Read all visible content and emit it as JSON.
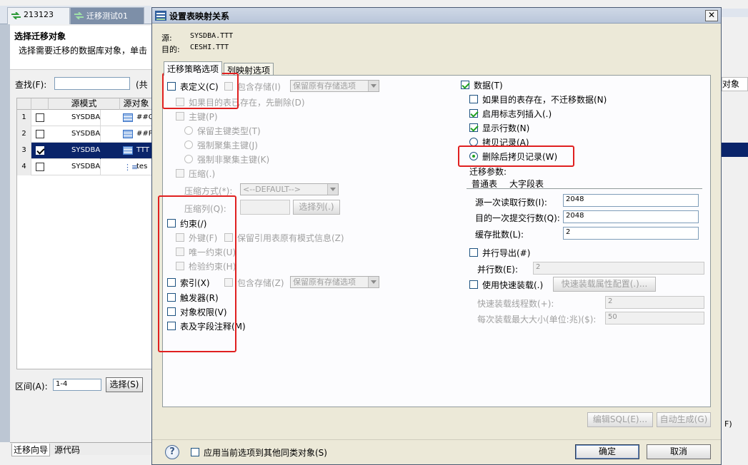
{
  "background": {
    "tabs": [
      {
        "label": "213123"
      },
      {
        "label": "迁移测试01"
      }
    ],
    "wizard_title": "选择迁移对象",
    "wizard_desc": "选择需要迁移的数据库对象，单击",
    "search_label": "查找(F):",
    "search_value": "",
    "search_count": "(共",
    "grid": {
      "headers": [
        "源模式",
        "源对象"
      ],
      "rows": [
        {
          "num": "1",
          "checked": false,
          "schema": "SYSDBA",
          "object": "##O"
        },
        {
          "num": "2",
          "checked": false,
          "schema": "SYSDBA",
          "object": "##P"
        },
        {
          "num": "3",
          "checked": true,
          "schema": "SYSDBA",
          "object": "TTT"
        },
        {
          "num": "4",
          "checked": false,
          "schema": "SYSDBA",
          "object": "tes"
        }
      ]
    },
    "range_label": "区间(A):",
    "range_value": "1-4",
    "select_button": "选择(S)",
    "bottom_tabs": [
      "迁移向导",
      "源代码"
    ],
    "right_object_label": "对象",
    "right_f_label": "F)"
  },
  "dialog": {
    "title": "设置表映射关系",
    "close": "✕",
    "source_label": "源:",
    "source_value": "SYSDBA.TTT",
    "target_label": "目的:",
    "target_value": "CESHI.TTT",
    "tabs": [
      "迁移策略选项",
      "列映射选项"
    ],
    "left": {
      "table_def": "表定义(C)",
      "include_storage": "包含存储(I)",
      "keep_storage_option": "保留原有存储选项",
      "drop_if_exists": "如果目的表已存在，先删除(D)",
      "primary_key": "主键(P)",
      "keep_pk_type": "保留主键类型(T)",
      "force_clustered": "强制聚集主键(J)",
      "force_nonclustered": "强制非聚集主键(K)",
      "compress": "压缩(.)",
      "compress_mode_label": "压缩方式(*):",
      "compress_mode_value": "<--DEFAULT-->",
      "compress_cols_label": "压缩列(Q):",
      "select_cols_button": "选择列(.)",
      "constraint": "约束(/)",
      "foreign_key": "外键(F)",
      "keep_ref_schema": "保留引用表原有模式信息(Z)",
      "unique": "唯一约束(U)",
      "check": "检验约束(H)",
      "index": "索引(X)",
      "index_include_storage": "包含存储(Z)",
      "index_keep_storage": "保留原有存储选项",
      "trigger": "触发器(R)",
      "obj_privilege": "对象权限(V)",
      "comments": "表及字段注释(M)"
    },
    "right": {
      "data": "数据(T)",
      "skip_if_exists": "如果目的表存在，不迁移数据(N)",
      "identity_insert": "启用标志列插入(.)",
      "show_rows": "显示行数(N)",
      "copy_records": "拷贝记录(A)",
      "delete_then_copy": "删除后拷贝记录(W)",
      "migrate_params": "迁移参数:",
      "subtabs": [
        "普通表",
        "大字段表"
      ],
      "src_read_label": "源一次读取行数(I):",
      "src_read_value": "2048",
      "dst_commit_label": "目的一次提交行数(Q):",
      "dst_commit_value": "2048",
      "cache_batch_label": "缓存批数(L):",
      "cache_batch_value": "2",
      "parallel_export": "并行导出(#)",
      "parallel_count_label": "并行数(E):",
      "parallel_count_value": "2",
      "fast_load": "使用快速装载(.)",
      "fast_load_config": "快速装载属性配置(.)...",
      "fast_threads_label": "快速装载线程数(+):",
      "fast_threads_value": "2",
      "fast_max_label": "每次装载最大大小(单位:兆)($):",
      "fast_max_value": "50"
    },
    "edit_sql": "编辑SQL(E)...",
    "auto_gen": "自动生成(G)",
    "help": "?",
    "apply_all": "应用当前选项到其他同类对象(S)",
    "ok": "确定",
    "cancel": "取消"
  },
  "colors": {
    "highlight_box": "#e02020",
    "selected_row": "#0a246a",
    "check": "#21a121"
  }
}
